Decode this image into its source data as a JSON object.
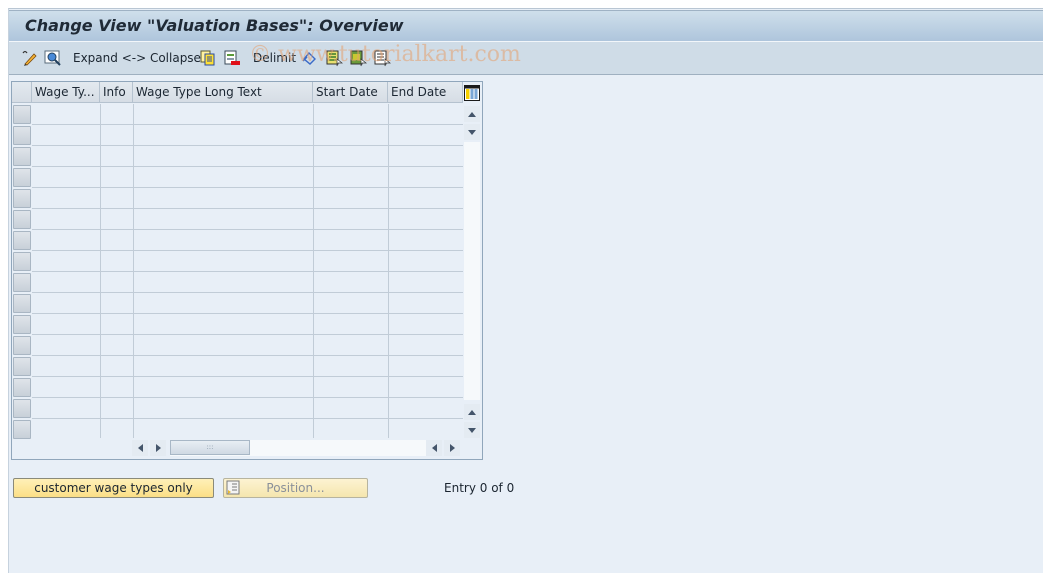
{
  "window": {
    "title": "Change View \"Valuation Bases\": Overview"
  },
  "toolbar": {
    "items": [
      {
        "icon": "display-change-icon"
      },
      {
        "icon": "find-icon"
      },
      {
        "label": "Expand <-> Collapse"
      },
      {
        "icon": "copy-as-icon"
      },
      {
        "icon": "delete-icon"
      },
      {
        "label": "Delimit"
      },
      {
        "icon": "undo-change-icon"
      },
      {
        "icon": "select-all-icon"
      },
      {
        "icon": "select-block-icon"
      },
      {
        "icon": "deselect-all-icon"
      }
    ],
    "expand_collapse_label": "Expand <-> Collapse",
    "delimit_label": "Delimit"
  },
  "watermark": "© www.tutorialkart.com",
  "table": {
    "columns": [
      {
        "label": "Wage Ty..."
      },
      {
        "label": "Info"
      },
      {
        "label": "Wage Type Long Text"
      },
      {
        "label": "Start Date"
      },
      {
        "label": "End Date"
      }
    ],
    "rows": [],
    "visible_empty_rows": 16,
    "config_icon": "table-settings-icon"
  },
  "footer": {
    "customer_button": "customer wage types only",
    "position_button": "Position...",
    "entry_text": "Entry 0 of 0"
  },
  "colors": {
    "button_yellow": "#fbdf86",
    "title_bar": "#aec5dc",
    "background": "#e8eff7"
  }
}
